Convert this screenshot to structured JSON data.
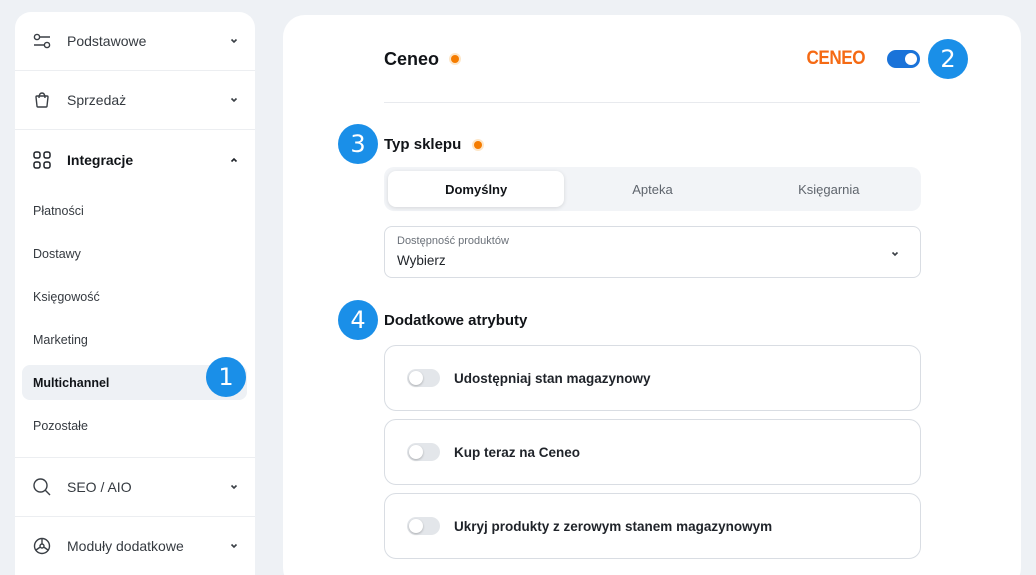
{
  "sidebar": {
    "groups": [
      {
        "label": "Podstawowe",
        "icon": "sliders-icon"
      },
      {
        "label": "Sprzedaż",
        "icon": "shopping-bag-icon"
      },
      {
        "label": "Integracje",
        "icon": "grid-icon"
      },
      {
        "label": "SEO / AIO",
        "icon": "search-icon"
      },
      {
        "label": "Moduły dodatkowe",
        "icon": "modules-icon"
      }
    ],
    "integracje_items": [
      "Płatności",
      "Dostawy",
      "Księgowość",
      "Marketing",
      "Multichannel",
      "Pozostałe"
    ],
    "selected_item": "Multichannel"
  },
  "markers": [
    "1",
    "2",
    "3",
    "4"
  ],
  "header": {
    "title": "Ceneo",
    "brand_logo_text": "CENEO",
    "enabled": true
  },
  "shop_type": {
    "title": "Typ sklepu",
    "tabs": [
      "Domyślny",
      "Apteka",
      "Księgarnia"
    ],
    "active_tab": "Domyślny"
  },
  "availability": {
    "label": "Dostępność produktów",
    "value": "Wybierz"
  },
  "attributes": {
    "title": "Dodatkowe atrybuty",
    "items": [
      {
        "label": "Udostępniaj stan magazynowy",
        "enabled": false
      },
      {
        "label": "Kup teraz na Ceneo",
        "enabled": false
      },
      {
        "label": "Ukryj produkty z zerowym stanem magazynowym",
        "enabled": false
      }
    ]
  },
  "colors": {
    "accent_blue": "#1a73d9",
    "marker_blue": "#1a8fe8",
    "brand_orange": "#f56a14",
    "dot_orange": "#f57c00",
    "background": "#eef1f5"
  }
}
